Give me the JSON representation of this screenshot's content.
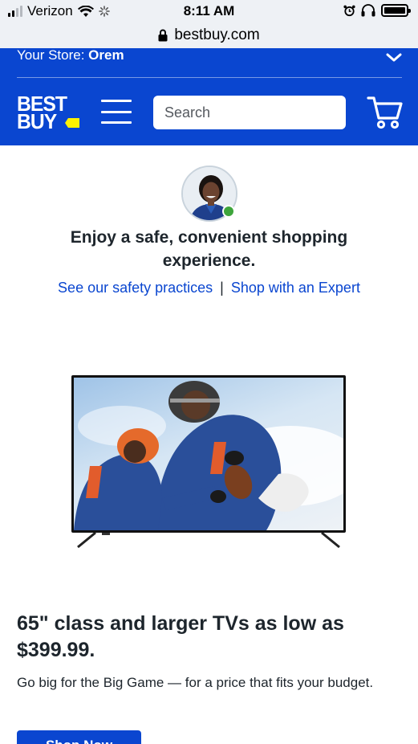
{
  "status_bar": {
    "carrier": "Verizon",
    "time": "8:11 AM"
  },
  "browser": {
    "url": "bestbuy.com"
  },
  "header": {
    "store_label": "Your Store:",
    "store_name": "Orem",
    "logo_text_line1": "BEST",
    "logo_text_line2": "BUY",
    "search_placeholder": "Search",
    "colors": {
      "brand_blue": "#0a46d0",
      "logo_tag_yellow": "#fff200"
    }
  },
  "expert": {
    "heading": "Enjoy a safe, convenient shopping experience.",
    "link_safety": "See our safety practices",
    "link_separator": "|",
    "link_expert": "Shop with an Expert",
    "status_color": "#3ea53b"
  },
  "promo": {
    "title": "65\" class and larger TVs as low as $399.99.",
    "subtitle": "Go big for the Big Game — for a price that fits your budget.",
    "button_label": "Shop Now"
  }
}
